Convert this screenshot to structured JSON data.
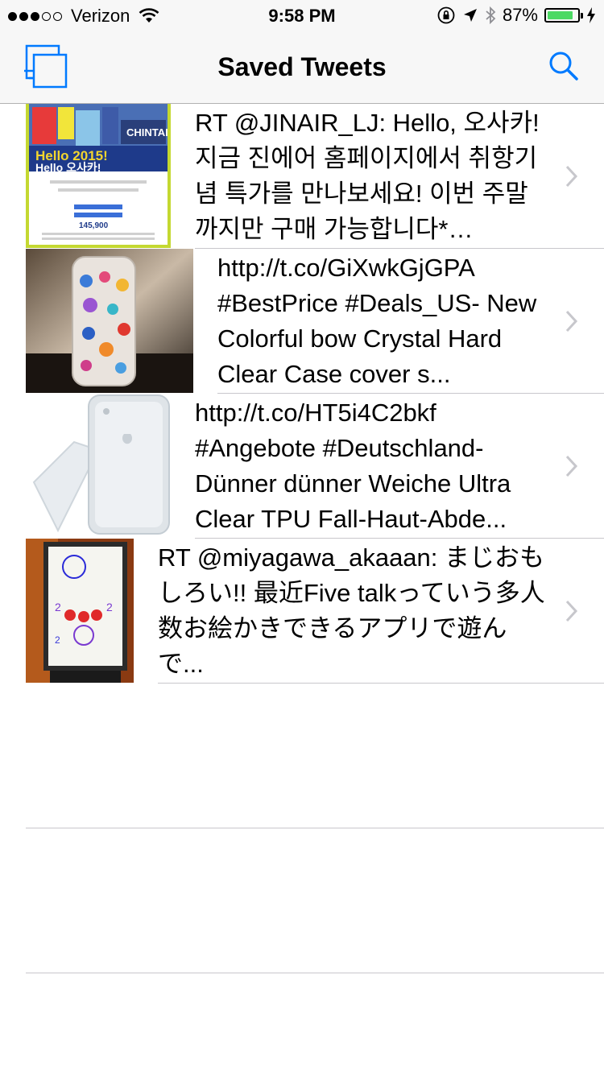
{
  "status_bar": {
    "carrier": "Verizon",
    "signal_filled": 3,
    "signal_total": 5,
    "time": "9:58 PM",
    "battery": "87%",
    "battery_level": 0.87,
    "battery_color": "#4cd964"
  },
  "nav": {
    "title": "Saved Tweets",
    "left_icon": "stacked-pages-icon",
    "right_icon": "search-icon",
    "tint": "#007aff"
  },
  "tweets": [
    {
      "text": "RT @JINAIR_LJ: Hello, 오사카! 지금 진에어 홈페이지에서 취항기념 특가를 만나보세요! 이번 주말까지만 구매 가능합니다* http://t.co/...",
      "thumb": "jinair-ad-thumbnail"
    },
    {
      "text": "http://t.co/GiXwkGjGPA #BestPrice #Deals_US- New Colorful bow Crystal Hard Clear Case cover s...",
      "thumb": "crystal-phone-case-thumbnail"
    },
    {
      "text": "http://t.co/HT5i4C2bkf #Angebote #Deutschland- Dünner dünner Weiche Ultra Clear TPU Fall-Haut-Abde...",
      "thumb": "clear-phone-case-thumbnail"
    },
    {
      "text": "RT @miyagawa_akaaan: まじおもしろい!! 最近Five talkっていう多人数お絵かきできるアプリで遊んで...",
      "thumb": "drawing-board-thumbnail"
    }
  ]
}
